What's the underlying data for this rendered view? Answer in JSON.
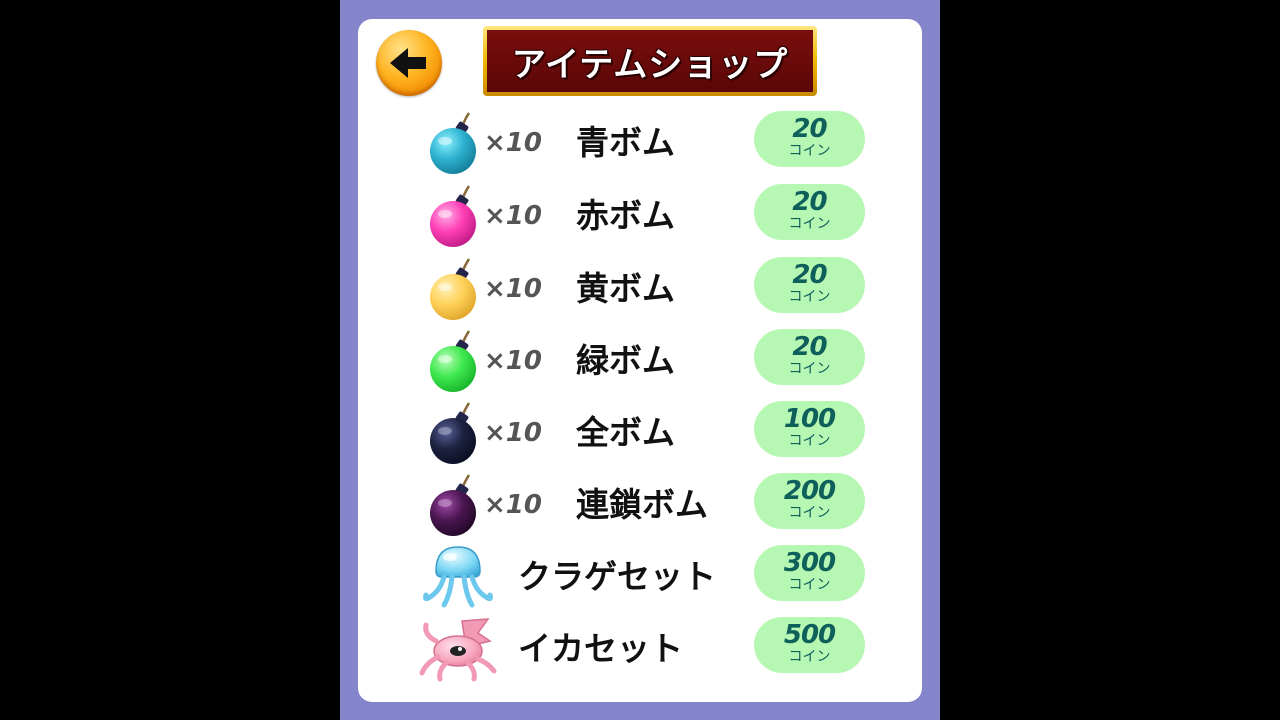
{
  "header": {
    "title": "アイテムショップ",
    "back_icon": "arrow-left-icon"
  },
  "colors": {
    "frame": "#8585cc",
    "price_bg": "#b6f7b3",
    "price_text": "#0f5f5a"
  },
  "items": [
    {
      "icon": "blue-bomb-icon",
      "color": "#2fb3d1",
      "qty": "×10",
      "name": "青ボム",
      "price": "20",
      "unit": "コイン"
    },
    {
      "icon": "red-bomb-icon",
      "color": "#ff3fb6",
      "qty": "×10",
      "name": "赤ボム",
      "price": "20",
      "unit": "コイン"
    },
    {
      "icon": "yellow-bomb-icon",
      "color": "#ffd25a",
      "qty": "×10",
      "name": "黄ボム",
      "price": "20",
      "unit": "コイン"
    },
    {
      "icon": "green-bomb-icon",
      "color": "#3fe84f",
      "qty": "×10",
      "name": "緑ボム",
      "price": "20",
      "unit": "コイン"
    },
    {
      "icon": "all-bomb-icon",
      "color": "#1d2240",
      "qty": "×10",
      "name": "全ボム",
      "price": "100",
      "unit": "コイン"
    },
    {
      "icon": "chain-bomb-icon",
      "color": "#4a1650",
      "qty": "×10",
      "name": "連鎖ボム",
      "price": "200",
      "unit": "コイン"
    },
    {
      "icon": "jellyfish-icon",
      "name": "クラゲセット",
      "price": "300",
      "unit": "コイン"
    },
    {
      "icon": "squid-icon",
      "name": "イカセット",
      "price": "500",
      "unit": "コイン"
    }
  ]
}
